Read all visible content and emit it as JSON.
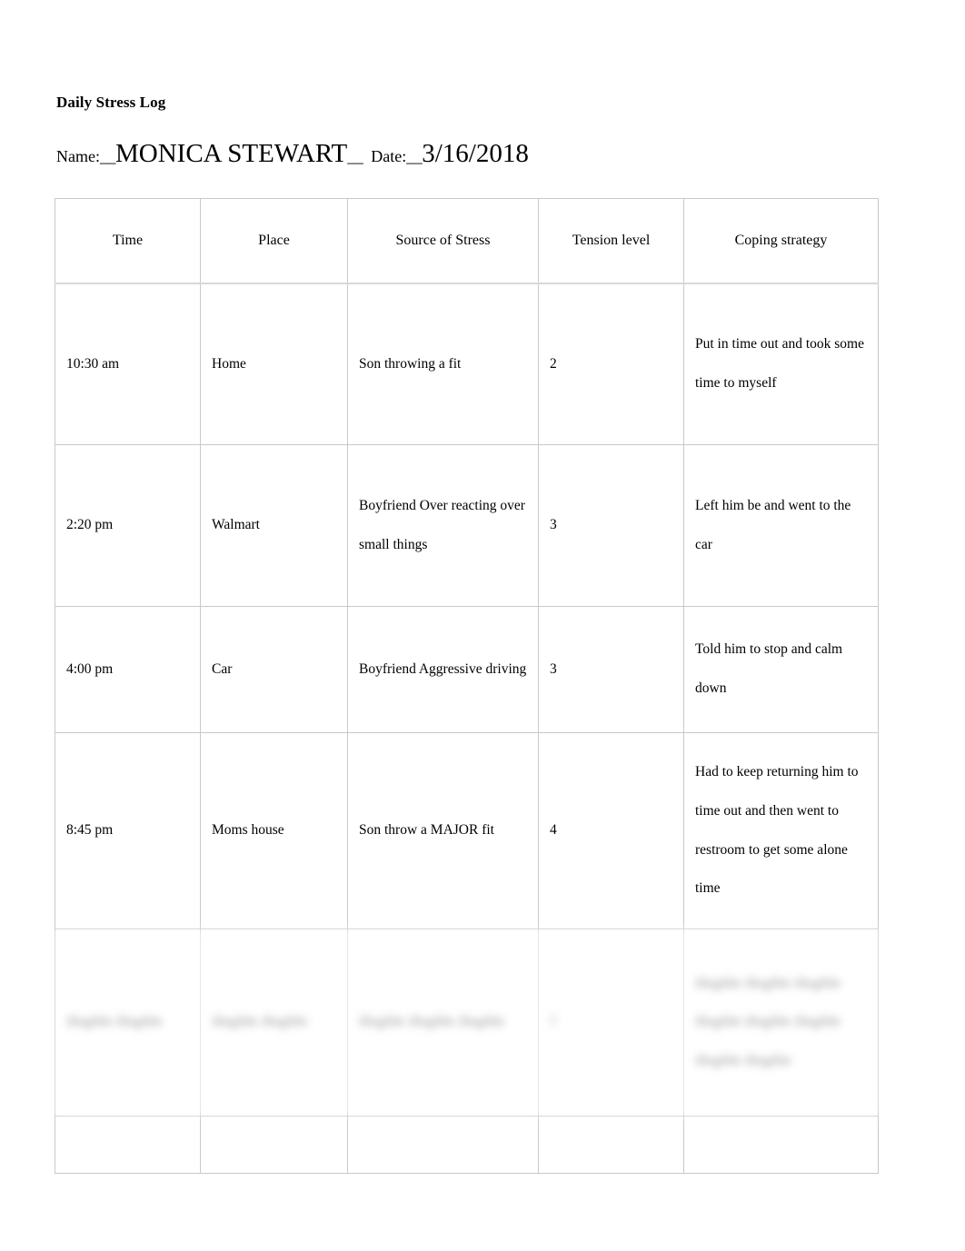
{
  "document": {
    "title": "Daily Stress Log"
  },
  "form": {
    "name_label": "Name:",
    "name_rule_left": "__",
    "name_value": "MONICA STEWART",
    "name_rule_right": "__",
    "date_label": "Date:",
    "date_rule_left": "__",
    "date_value": "3/16/2018"
  },
  "table": {
    "columns": [
      "Time",
      "Place",
      "Source of Stress",
      "Tension level",
      "Coping strategy"
    ],
    "rows": [
      {
        "time": "10:30 am",
        "place": "Home",
        "source": "Son throwing a fit",
        "tension": "2",
        "coping": "Put in time out and took some time to myself",
        "redacted": false,
        "place_large": false
      },
      {
        "time": "2:20 pm",
        "place": "Walmart",
        "source": "Boyfriend Over reacting over small things",
        "tension": "3",
        "coping": "Left him be and went to the car",
        "redacted": false,
        "place_large": true
      },
      {
        "time": "4:00 pm",
        "place": "Car",
        "source": "Boyfriend Aggressive driving",
        "tension": "3",
        "coping": "Told him to stop and calm down",
        "redacted": false,
        "place_large": true
      },
      {
        "time": "8:45 pm",
        "place": "Moms house",
        "source": "Son throw a MAJOR fit",
        "tension": "4",
        "coping": "Had to keep returning him to time out and then went to restroom to get some alone time",
        "redacted": false,
        "place_large": true
      },
      {
        "time": "illegible illegible",
        "place": "illegible illegible",
        "source": "illegible illegible illegible",
        "tension": "?",
        "coping": "illegible illegible illegible illegible illegible illegible illegible illegible",
        "redacted": true,
        "place_large": false
      },
      {
        "time": "",
        "place": "",
        "source": "",
        "tension": "",
        "coping": "",
        "redacted": false,
        "place_large": false
      }
    ]
  },
  "colors": {
    "page_background": "#ffffff",
    "text": "#000000",
    "table_border": "#c9c9c9",
    "row_divider": "#dcdcdc"
  }
}
